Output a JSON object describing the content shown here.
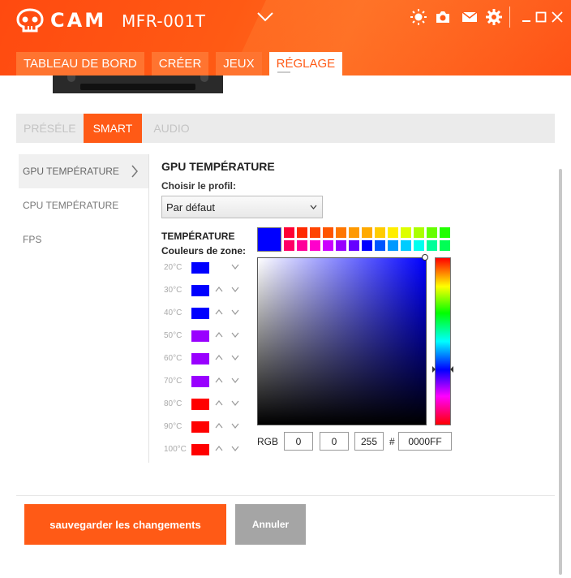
{
  "app": {
    "name": "CAM",
    "device": "MFR-001T"
  },
  "nav_tabs": [
    "TABLEAU DE BORD",
    "CRÉER",
    "JEUX",
    "RÉGLAGE"
  ],
  "sub_tabs": [
    "PRÉSÉLE",
    "SMART",
    "AUDIO"
  ],
  "left_menu": [
    "GPU TEMPÉRATURE",
    "CPU TEMPÉRATURE",
    "FPS"
  ],
  "panel": {
    "title": "GPU TEMPÉRATURE",
    "profile_label": "Choisir le profil:",
    "profile_value": "Par défaut",
    "temp_label_1": "TEMPÉRATURE",
    "temp_label_2": "Couleurs de zone:"
  },
  "zones": [
    {
      "label": "20°C",
      "color": "#0000ff"
    },
    {
      "label": "30°C",
      "color": "#0000ff"
    },
    {
      "label": "40°C",
      "color": "#0000ff"
    },
    {
      "label": "50°C",
      "color": "#9900ff"
    },
    {
      "label": "60°C",
      "color": "#9900ff"
    },
    {
      "label": "70°C",
      "color": "#9900ff"
    },
    {
      "label": "80°C",
      "color": "#ff0000"
    },
    {
      "label": "90°C",
      "color": "#ff0000"
    },
    {
      "label": "100°C",
      "color": "#ff0000"
    }
  ],
  "picker": {
    "current_color": "#0000ff",
    "rgb_label": "RGB",
    "r": "0",
    "g": "0",
    "b": "255",
    "hash": "#",
    "hex": "0000FF",
    "palette_row1": [
      "#ff0033",
      "#ff2a00",
      "#ff4400",
      "#ff5500",
      "#ff7700",
      "#ff9900",
      "#ffaa00",
      "#ffcc00",
      "#ffee00",
      "#ddff00",
      "#aaff00",
      "#66ff00",
      "#22ff00"
    ],
    "palette_row2": [
      "#ff0066",
      "#ff0099",
      "#ff00cc",
      "#cc00ff",
      "#9900ff",
      "#6600ff",
      "#0000ff",
      "#0055ff",
      "#0099ff",
      "#00ccff",
      "#00ffee",
      "#00ff99",
      "#00ff55"
    ]
  },
  "buttons": {
    "save": "sauvegarder les changements",
    "cancel": "Annuler"
  },
  "icons": [
    "skull-logo-icon",
    "chevron-down-icon",
    "brightness-icon",
    "camera-icon",
    "mail-icon",
    "gear-icon",
    "minimize-icon",
    "maximize-icon",
    "close-icon"
  ]
}
